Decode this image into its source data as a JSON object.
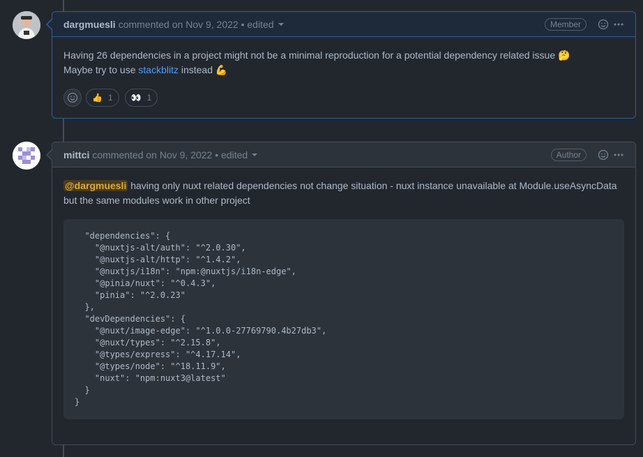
{
  "comments": [
    {
      "author": "dargmuesli",
      "meta": "commented on Nov 9, 2022 • edited",
      "role": "Member",
      "body_line1": "Having 26 dependencies in a project might not be a minimal reproduction for a potential dependency related issue",
      "body_line1_emoji": "🤔",
      "body_line2_pre": "Maybe try to use ",
      "body_line2_link": "stackblitz",
      "body_line2_post": " instead",
      "body_line2_emoji": "💪",
      "reactions": [
        {
          "emoji": "👍",
          "count": "1"
        },
        {
          "emoji": "👀",
          "count": "1"
        }
      ]
    },
    {
      "author": "mittci",
      "meta": "commented on Nov 9, 2022 • edited",
      "role": "Author",
      "mention": "@dargmuesli",
      "body_text": " having only nuxt related dependencies not change situation - nuxt instance unavailable at Module.useAsyncData but the same modules work in other project",
      "code": "  \"dependencies\": {\n    \"@nuxtjs-alt/auth\": \"^2.0.30\",\n    \"@nuxtjs-alt/http\": \"^1.4.2\",\n    \"@nuxtjs/i18n\": \"npm:@nuxtjs/i18n-edge\",\n    \"@pinia/nuxt\": \"^0.4.3\",\n    \"pinia\": \"^2.0.23\"\n  },\n  \"devDependencies\": {\n    \"@nuxt/image-edge\": \"^1.0.0-27769790.4b27db3\",\n    \"@nuxt/types\": \"^2.15.8\",\n    \"@types/express\": \"^4.17.14\",\n    \"@types/node\": \"^18.11.9\",\n    \"nuxt\": \"npm:nuxt3@latest\"\n  }\n}"
    }
  ],
  "colors": {
    "background": "#22272e",
    "header": "#2d333b",
    "link": "#539bf5",
    "highlight_border": "#2f5f97",
    "mention_bg": "#4a3c1a"
  }
}
